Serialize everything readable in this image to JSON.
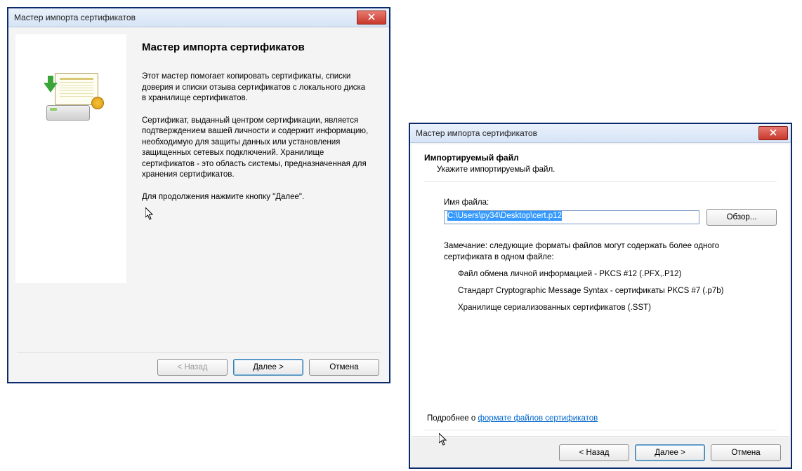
{
  "window1": {
    "title": "Мастер импорта сертификатов",
    "heading": "Мастер импорта сертификатов",
    "para1": "Этот мастер помогает копировать сертификаты, списки доверия и списки отзыва сертификатов с локального диска в хранилище сертификатов.",
    "para2": "Сертификат, выданный центром сертификации, является подтверждением вашей личности и содержит информацию, необходимую для защиты данных или установления защищенных сетевых подключений. Хранилище сертификатов - это область системы, предназначенная для хранения сертификатов.",
    "para3": "Для продолжения нажмите кнопку \"Далее\".",
    "buttons": {
      "back": "< Назад",
      "next": "Далее >",
      "cancel": "Отмена"
    }
  },
  "window2": {
    "title": "Мастер импорта сертификатов",
    "step_title": "Импортируемый файл",
    "step_sub": "Укажите импортируемый файл.",
    "field_label": "Имя файла:",
    "file_path": "C:\\Users\\py34\\Desktop\\cert.p12",
    "browse": "Обзор...",
    "note": "Замечание: следующие форматы файлов могут содержать более одного сертификата в одном файле:",
    "formats": {
      "f1": "Файл обмена личной информацией - PKCS #12 (.PFX,.P12)",
      "f2": "Стандарт Cryptographic Message Syntax - сертификаты PKCS #7 (.p7b)",
      "f3": "Хранилище сериализованных сертификатов (.SST)"
    },
    "more_prefix": "Подробнее о ",
    "more_link": "формате файлов сертификатов",
    "buttons": {
      "back": "< Назад",
      "next": "Далее >",
      "cancel": "Отмена"
    }
  }
}
